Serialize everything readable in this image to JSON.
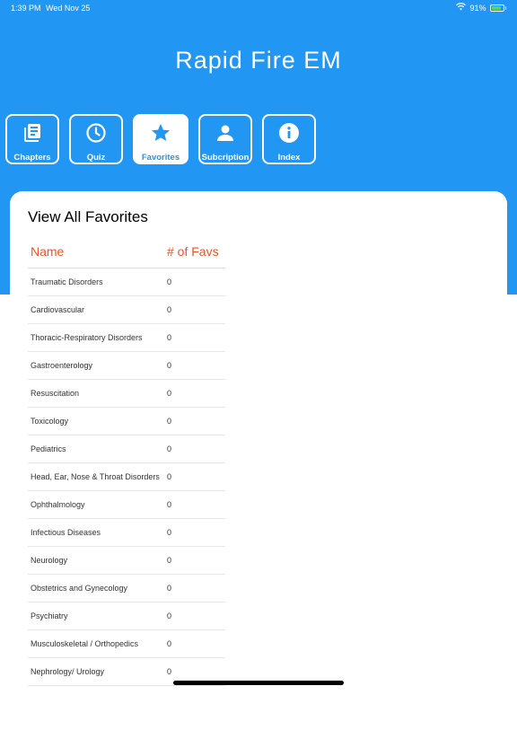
{
  "status_bar": {
    "time": "1:39 PM",
    "date": "Wed Nov 25",
    "battery_percent": "91%",
    "battery_level": 0.91
  },
  "app": {
    "title": "Rapid Fire EM"
  },
  "nav": {
    "tabs": [
      {
        "label": "Chapters",
        "icon": "chapters-icon",
        "active": false
      },
      {
        "label": "Quiz",
        "icon": "clock-icon",
        "active": false
      },
      {
        "label": "Favorites",
        "icon": "star-icon",
        "active": true
      },
      {
        "label": "Subcription",
        "icon": "person-icon",
        "active": false
      },
      {
        "label": "Index",
        "icon": "info-icon",
        "active": false
      }
    ]
  },
  "favorites": {
    "title": "View All Favorites",
    "columns": [
      "Name",
      "# of Favs"
    ],
    "rows": [
      {
        "name": "Traumatic Disorders",
        "count": "0"
      },
      {
        "name": "Cardiovascular",
        "count": "0"
      },
      {
        "name": "Thoracic-Respiratory Disorders",
        "count": "0"
      },
      {
        "name": "Gastroenterology",
        "count": "0"
      },
      {
        "name": "Resuscitation",
        "count": "0"
      },
      {
        "name": "Toxicology",
        "count": "0"
      },
      {
        "name": "Pediatrics",
        "count": "0"
      },
      {
        "name": "Head, Ear, Nose & Throat Disorders",
        "count": "0"
      },
      {
        "name": "Ophthalmology",
        "count": "0"
      },
      {
        "name": "Infectious Diseases",
        "count": "0"
      },
      {
        "name": "Neurology",
        "count": "0"
      },
      {
        "name": "Obstetrics and Gynecology",
        "count": "0"
      },
      {
        "name": "Psychiatry",
        "count": "0"
      },
      {
        "name": "Musculoskeletal / Orthopedics",
        "count": "0"
      },
      {
        "name": "Nephrology/ Urology",
        "count": "0"
      }
    ]
  },
  "colors": {
    "primary": "#2196f3",
    "header_text": "#f4511e",
    "battery_fill": "#4cd964"
  }
}
